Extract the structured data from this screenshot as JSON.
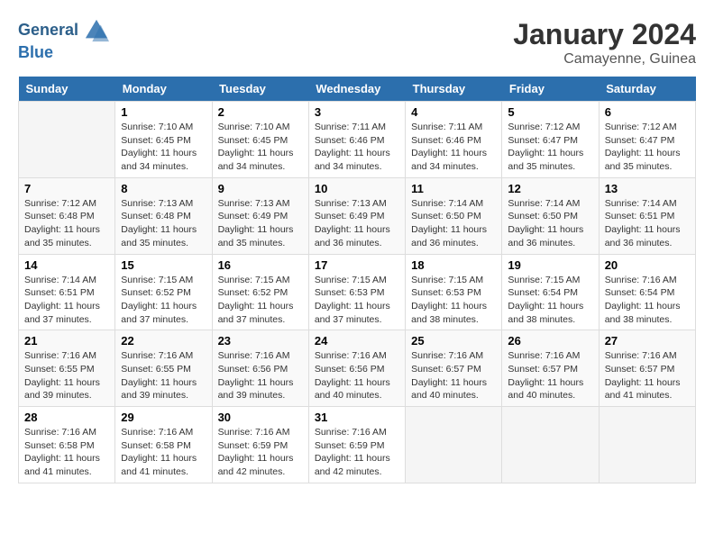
{
  "header": {
    "logo_line1": "General",
    "logo_line2": "Blue",
    "month_year": "January 2024",
    "location": "Camayenne, Guinea"
  },
  "days_of_week": [
    "Sunday",
    "Monday",
    "Tuesday",
    "Wednesday",
    "Thursday",
    "Friday",
    "Saturday"
  ],
  "weeks": [
    [
      {
        "num": "",
        "sunrise": "",
        "sunset": "",
        "daylight": ""
      },
      {
        "num": "1",
        "sunrise": "Sunrise: 7:10 AM",
        "sunset": "Sunset: 6:45 PM",
        "daylight": "Daylight: 11 hours and 34 minutes."
      },
      {
        "num": "2",
        "sunrise": "Sunrise: 7:10 AM",
        "sunset": "Sunset: 6:45 PM",
        "daylight": "Daylight: 11 hours and 34 minutes."
      },
      {
        "num": "3",
        "sunrise": "Sunrise: 7:11 AM",
        "sunset": "Sunset: 6:46 PM",
        "daylight": "Daylight: 11 hours and 34 minutes."
      },
      {
        "num": "4",
        "sunrise": "Sunrise: 7:11 AM",
        "sunset": "Sunset: 6:46 PM",
        "daylight": "Daylight: 11 hours and 34 minutes."
      },
      {
        "num": "5",
        "sunrise": "Sunrise: 7:12 AM",
        "sunset": "Sunset: 6:47 PM",
        "daylight": "Daylight: 11 hours and 35 minutes."
      },
      {
        "num": "6",
        "sunrise": "Sunrise: 7:12 AM",
        "sunset": "Sunset: 6:47 PM",
        "daylight": "Daylight: 11 hours and 35 minutes."
      }
    ],
    [
      {
        "num": "7",
        "sunrise": "Sunrise: 7:12 AM",
        "sunset": "Sunset: 6:48 PM",
        "daylight": "Daylight: 11 hours and 35 minutes."
      },
      {
        "num": "8",
        "sunrise": "Sunrise: 7:13 AM",
        "sunset": "Sunset: 6:48 PM",
        "daylight": "Daylight: 11 hours and 35 minutes."
      },
      {
        "num": "9",
        "sunrise": "Sunrise: 7:13 AM",
        "sunset": "Sunset: 6:49 PM",
        "daylight": "Daylight: 11 hours and 35 minutes."
      },
      {
        "num": "10",
        "sunrise": "Sunrise: 7:13 AM",
        "sunset": "Sunset: 6:49 PM",
        "daylight": "Daylight: 11 hours and 36 minutes."
      },
      {
        "num": "11",
        "sunrise": "Sunrise: 7:14 AM",
        "sunset": "Sunset: 6:50 PM",
        "daylight": "Daylight: 11 hours and 36 minutes."
      },
      {
        "num": "12",
        "sunrise": "Sunrise: 7:14 AM",
        "sunset": "Sunset: 6:50 PM",
        "daylight": "Daylight: 11 hours and 36 minutes."
      },
      {
        "num": "13",
        "sunrise": "Sunrise: 7:14 AM",
        "sunset": "Sunset: 6:51 PM",
        "daylight": "Daylight: 11 hours and 36 minutes."
      }
    ],
    [
      {
        "num": "14",
        "sunrise": "Sunrise: 7:14 AM",
        "sunset": "Sunset: 6:51 PM",
        "daylight": "Daylight: 11 hours and 37 minutes."
      },
      {
        "num": "15",
        "sunrise": "Sunrise: 7:15 AM",
        "sunset": "Sunset: 6:52 PM",
        "daylight": "Daylight: 11 hours and 37 minutes."
      },
      {
        "num": "16",
        "sunrise": "Sunrise: 7:15 AM",
        "sunset": "Sunset: 6:52 PM",
        "daylight": "Daylight: 11 hours and 37 minutes."
      },
      {
        "num": "17",
        "sunrise": "Sunrise: 7:15 AM",
        "sunset": "Sunset: 6:53 PM",
        "daylight": "Daylight: 11 hours and 37 minutes."
      },
      {
        "num": "18",
        "sunrise": "Sunrise: 7:15 AM",
        "sunset": "Sunset: 6:53 PM",
        "daylight": "Daylight: 11 hours and 38 minutes."
      },
      {
        "num": "19",
        "sunrise": "Sunrise: 7:15 AM",
        "sunset": "Sunset: 6:54 PM",
        "daylight": "Daylight: 11 hours and 38 minutes."
      },
      {
        "num": "20",
        "sunrise": "Sunrise: 7:16 AM",
        "sunset": "Sunset: 6:54 PM",
        "daylight": "Daylight: 11 hours and 38 minutes."
      }
    ],
    [
      {
        "num": "21",
        "sunrise": "Sunrise: 7:16 AM",
        "sunset": "Sunset: 6:55 PM",
        "daylight": "Daylight: 11 hours and 39 minutes."
      },
      {
        "num": "22",
        "sunrise": "Sunrise: 7:16 AM",
        "sunset": "Sunset: 6:55 PM",
        "daylight": "Daylight: 11 hours and 39 minutes."
      },
      {
        "num": "23",
        "sunrise": "Sunrise: 7:16 AM",
        "sunset": "Sunset: 6:56 PM",
        "daylight": "Daylight: 11 hours and 39 minutes."
      },
      {
        "num": "24",
        "sunrise": "Sunrise: 7:16 AM",
        "sunset": "Sunset: 6:56 PM",
        "daylight": "Daylight: 11 hours and 40 minutes."
      },
      {
        "num": "25",
        "sunrise": "Sunrise: 7:16 AM",
        "sunset": "Sunset: 6:57 PM",
        "daylight": "Daylight: 11 hours and 40 minutes."
      },
      {
        "num": "26",
        "sunrise": "Sunrise: 7:16 AM",
        "sunset": "Sunset: 6:57 PM",
        "daylight": "Daylight: 11 hours and 40 minutes."
      },
      {
        "num": "27",
        "sunrise": "Sunrise: 7:16 AM",
        "sunset": "Sunset: 6:57 PM",
        "daylight": "Daylight: 11 hours and 41 minutes."
      }
    ],
    [
      {
        "num": "28",
        "sunrise": "Sunrise: 7:16 AM",
        "sunset": "Sunset: 6:58 PM",
        "daylight": "Daylight: 11 hours and 41 minutes."
      },
      {
        "num": "29",
        "sunrise": "Sunrise: 7:16 AM",
        "sunset": "Sunset: 6:58 PM",
        "daylight": "Daylight: 11 hours and 41 minutes."
      },
      {
        "num": "30",
        "sunrise": "Sunrise: 7:16 AM",
        "sunset": "Sunset: 6:59 PM",
        "daylight": "Daylight: 11 hours and 42 minutes."
      },
      {
        "num": "31",
        "sunrise": "Sunrise: 7:16 AM",
        "sunset": "Sunset: 6:59 PM",
        "daylight": "Daylight: 11 hours and 42 minutes."
      },
      {
        "num": "",
        "sunrise": "",
        "sunset": "",
        "daylight": ""
      },
      {
        "num": "",
        "sunrise": "",
        "sunset": "",
        "daylight": ""
      },
      {
        "num": "",
        "sunrise": "",
        "sunset": "",
        "daylight": ""
      }
    ]
  ]
}
